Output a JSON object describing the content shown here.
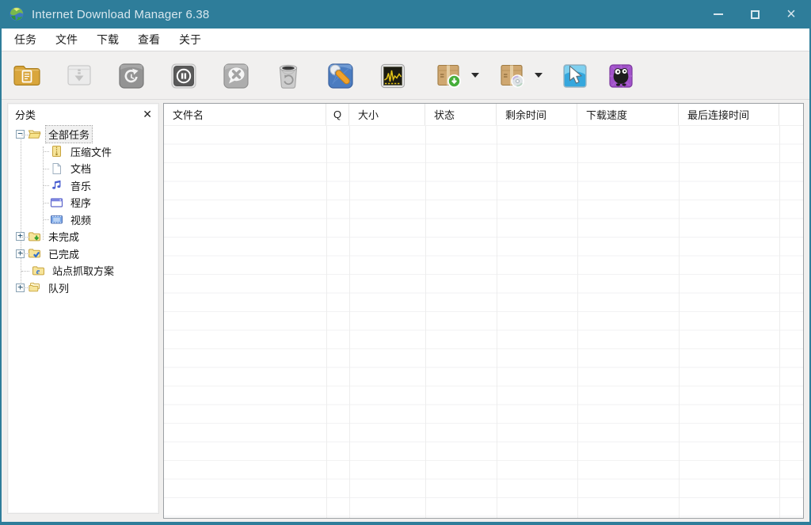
{
  "window": {
    "title": "Internet Download Manager 6.38",
    "app_icon": "idm-logo-icon",
    "controls": {
      "minimize": "minimize-button",
      "maximize": "maximize-button",
      "close": "close-button"
    }
  },
  "menu": {
    "items": [
      {
        "label": "任务"
      },
      {
        "label": "文件"
      },
      {
        "label": "下载"
      },
      {
        "label": "查看"
      },
      {
        "label": "关于"
      }
    ]
  },
  "toolbar": {
    "buttons": [
      {
        "name": "add-url-icon",
        "enabled": true
      },
      {
        "name": "resume-download-icon",
        "enabled": false
      },
      {
        "name": "redownload-icon",
        "enabled": false
      },
      {
        "name": "stop-download-icon",
        "enabled": false
      },
      {
        "name": "stop-all-icon",
        "enabled": false
      },
      {
        "name": "delete-task-icon",
        "enabled": false
      },
      {
        "name": "options-wrench-icon",
        "enabled": true
      },
      {
        "name": "scheduler-icon",
        "enabled": true
      },
      {
        "name": "start-queue-icon",
        "enabled": true,
        "has_dropdown": true
      },
      {
        "name": "stop-queue-icon",
        "enabled": true,
        "has_dropdown": true
      },
      {
        "name": "grabber-cursor-icon",
        "enabled": true
      },
      {
        "name": "mascot-icon",
        "enabled": true
      }
    ]
  },
  "sidebar": {
    "title": "分类",
    "close_icon": "✕",
    "tree": [
      {
        "label": "全部任务",
        "depth": 0,
        "expander": "−",
        "icon": "folder-open-icon",
        "selected": true
      },
      {
        "label": "压缩文件",
        "depth": 1,
        "expander": "",
        "icon": "zip-file-icon",
        "selected": false
      },
      {
        "label": "文档",
        "depth": 1,
        "expander": "",
        "icon": "document-icon",
        "selected": false
      },
      {
        "label": "音乐",
        "depth": 1,
        "expander": "",
        "icon": "music-note-icon",
        "selected": false
      },
      {
        "label": "程序",
        "depth": 1,
        "expander": "",
        "icon": "program-window-icon",
        "selected": false
      },
      {
        "label": "视频",
        "depth": 1,
        "expander": "",
        "icon": "video-film-icon",
        "selected": false
      },
      {
        "label": "未完成",
        "depth": 0,
        "expander": "+",
        "icon": "folder-unfinished-icon",
        "selected": false
      },
      {
        "label": "已完成",
        "depth": 0,
        "expander": "+",
        "icon": "folder-finished-icon",
        "selected": false
      },
      {
        "label": "站点抓取方案",
        "depth": 0,
        "expander": "",
        "icon": "folder-grabber-icon",
        "selected": false
      },
      {
        "label": "队列",
        "depth": 0,
        "expander": "+",
        "icon": "queues-folders-icon",
        "selected": false
      }
    ]
  },
  "table": {
    "columns": [
      {
        "label": "文件名"
      },
      {
        "label": "Q"
      },
      {
        "label": "大小"
      },
      {
        "label": "状态"
      },
      {
        "label": "剩余时间"
      },
      {
        "label": "下载速度"
      },
      {
        "label": "最后连接时间"
      }
    ],
    "rows": []
  },
  "colors": {
    "titlebar": "#2e7d9a",
    "toolbar_bg": "#f1f0ef",
    "panel_border": "#9b9fa3",
    "gridline": "#f2f2f3"
  }
}
